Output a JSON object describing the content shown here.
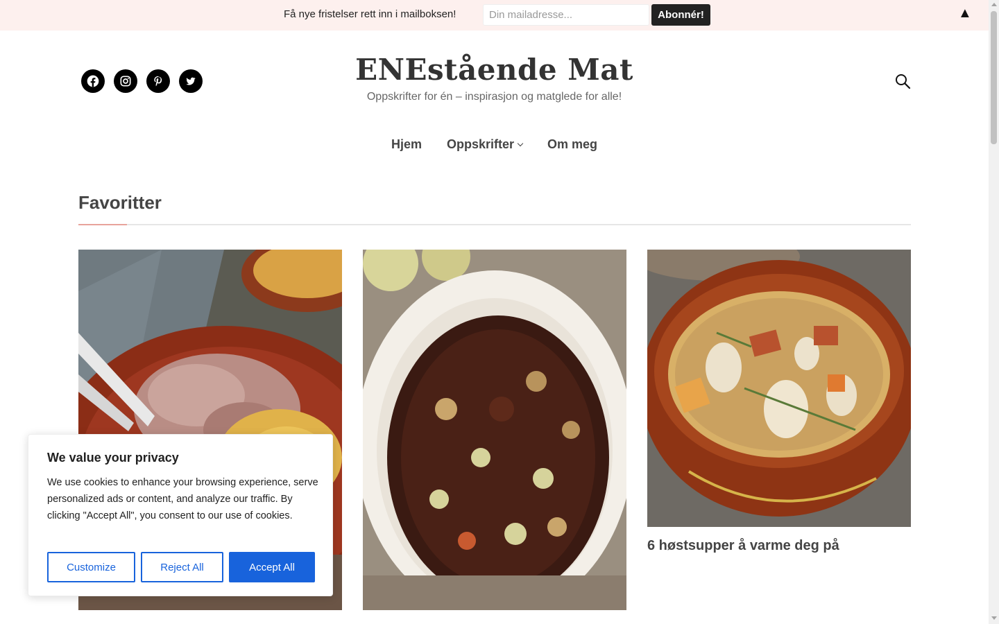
{
  "newsletter": {
    "text": "Få nye fristelser rett inn i mailboksen!",
    "placeholder": "Din mailadresse...",
    "button": "Abonnér!",
    "close_glyph": "▲"
  },
  "social": [
    "facebook-icon",
    "instagram-icon",
    "pinterest-icon",
    "twitter-icon"
  ],
  "header": {
    "title": "ENEstående Mat",
    "tagline": "Oppskrifter for én – inspirasjon og matglede for alle!"
  },
  "nav": {
    "home": "Hjem",
    "recipes": "Oppskrifter",
    "about": "Om meg"
  },
  "section": {
    "title": "Favoritter"
  },
  "cards": [
    {
      "title": "",
      "image": "pulled-meat-with-mash"
    },
    {
      "title": "",
      "image": "beef-stew-pot"
    },
    {
      "title": "6 høstsupper å varme deg på",
      "image": "bean-soup-bowl"
    }
  ],
  "cookie": {
    "title": "We value your privacy",
    "text": "We use cookies to enhance your browsing experience, serve personalized ads or content, and analyze our traffic. By clicking \"Accept All\", you consent to our use of cookies.",
    "customize": "Customize",
    "reject": "Reject All",
    "accept": "Accept All"
  },
  "colors": {
    "topbar_bg": "#fdf0ee",
    "accent": "#e8a39b",
    "cookie_blue": "#1863dc"
  }
}
